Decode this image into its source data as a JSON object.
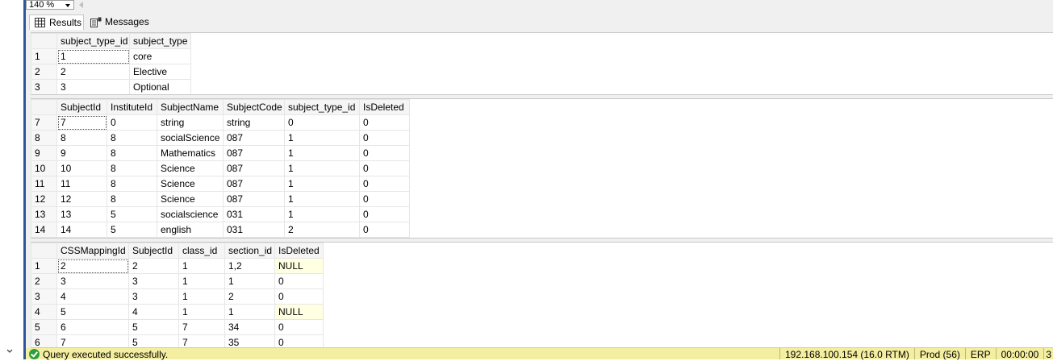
{
  "zoom": {
    "value": "140 %"
  },
  "tabs": {
    "results": "Results",
    "messages": "Messages"
  },
  "grid1": {
    "columns": [
      "subject_type_id",
      "subject_type"
    ],
    "rows": [
      [
        "1",
        "1",
        "core"
      ],
      [
        "2",
        "2",
        "Elective"
      ],
      [
        "3",
        "3",
        "Optional"
      ]
    ]
  },
  "grid2": {
    "columns": [
      "SubjectId",
      "InstituteId",
      "SubjectName",
      "SubjectCode",
      "subject_type_id",
      "IsDeleted"
    ],
    "rows": [
      [
        "7",
        "7",
        "0",
        "string",
        "string",
        "0",
        "0"
      ],
      [
        "8",
        "8",
        "8",
        "socialScience",
        "087",
        "1",
        "0"
      ],
      [
        "9",
        "9",
        "8",
        "Mathematics",
        "087",
        "1",
        "0"
      ],
      [
        "10",
        "10",
        "8",
        "Science",
        "087",
        "1",
        "0"
      ],
      [
        "11",
        "11",
        "8",
        "Science",
        "087",
        "1",
        "0"
      ],
      [
        "12",
        "12",
        "8",
        "Science",
        "087",
        "1",
        "0"
      ],
      [
        "13",
        "13",
        "5",
        "socialscience",
        "031",
        "1",
        "0"
      ],
      [
        "14",
        "14",
        "5",
        "english",
        "031",
        "2",
        "0"
      ]
    ]
  },
  "grid3": {
    "columns": [
      "CSSMappingId",
      "SubjectId",
      "class_id",
      "section_id",
      "IsDeleted"
    ],
    "rows": [
      [
        "1",
        "2",
        "2",
        "1",
        "1,2",
        "NULL"
      ],
      [
        "2",
        "3",
        "3",
        "1",
        "1",
        "0"
      ],
      [
        "3",
        "4",
        "3",
        "1",
        "2",
        "0"
      ],
      [
        "4",
        "5",
        "4",
        "1",
        "1",
        "NULL"
      ],
      [
        "5",
        "6",
        "5",
        "7",
        "34",
        "0"
      ],
      [
        "6",
        "7",
        "5",
        "7",
        "35",
        "0"
      ]
    ]
  },
  "status": {
    "message": "Query executed successfully.",
    "server": "192.168.100.154 (16.0 RTM)",
    "database_user": "Prod (56)",
    "database": "ERP",
    "elapsed": "00:00:00",
    "rows": "3"
  },
  "colors": {
    "status_bar": "#f3eea0",
    "left_border": "#2b579a",
    "null_cell": "#ffffe1",
    "ok_icon": "#2e9e3e"
  }
}
